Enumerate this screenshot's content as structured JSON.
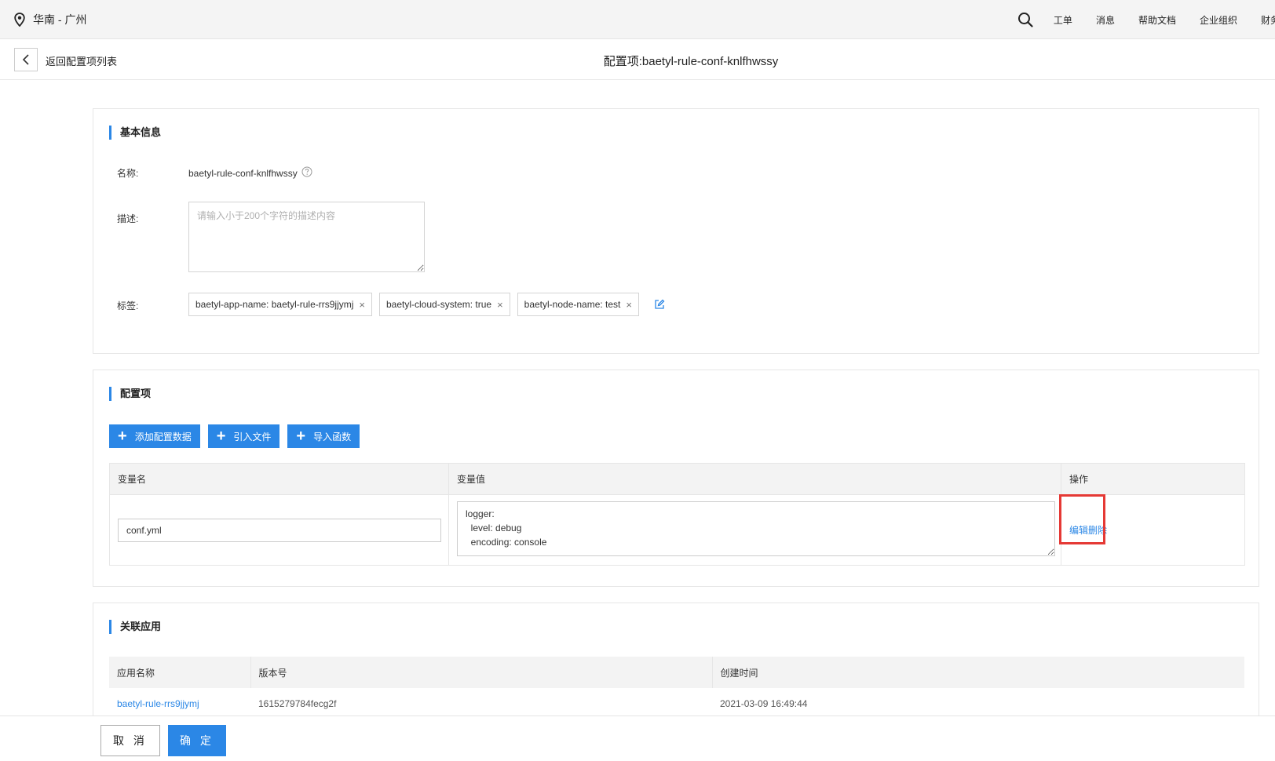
{
  "topbar": {
    "region": "华南 - 广州",
    "nav": [
      "工单",
      "消息",
      "帮助文档",
      "企业组织",
      "财务"
    ]
  },
  "subheader": {
    "back_label": "返回配置项列表",
    "title": "配置项:baetyl-rule-conf-knlfhwssy"
  },
  "basic": {
    "title": "基本信息",
    "name_label": "名称:",
    "name_value": "baetyl-rule-conf-knlfhwssy",
    "desc_label": "描述:",
    "desc_placeholder": "请输入小于200个字符的描述内容",
    "tags_label": "标签:",
    "tags": [
      "baetyl-app-name: baetyl-rule-rrs9jjymj",
      "baetyl-cloud-system: true",
      "baetyl-node-name: test"
    ]
  },
  "config": {
    "title": "配置项",
    "buttons": [
      "添加配置数据",
      "引入文件",
      "导入函数"
    ],
    "columns": [
      "变量名",
      "变量值",
      "操作"
    ],
    "rows": [
      {
        "name": "conf.yml",
        "value": "logger:\n  level: debug\n  encoding: console",
        "edit": "编辑",
        "delete": "删除"
      }
    ]
  },
  "apps": {
    "title": "关联应用",
    "columns": [
      "应用名称",
      "版本号",
      "创建时间"
    ],
    "rows": [
      {
        "name": "baetyl-rule-rrs9jjymj",
        "version": "1615279784fecg2f",
        "created": "2021-03-09 16:49:44"
      }
    ]
  },
  "footer": {
    "cancel": "取 消",
    "ok": "确 定"
  },
  "colors": {
    "accent": "#2b87e6",
    "highlight": "#e53935"
  }
}
